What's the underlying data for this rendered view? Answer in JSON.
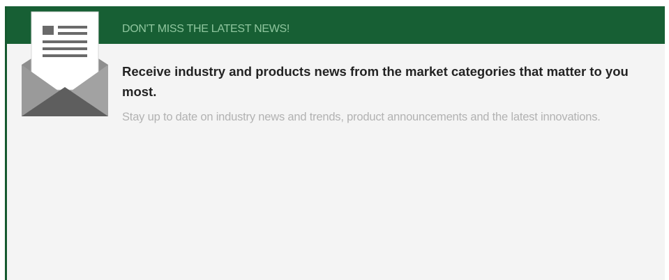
{
  "newsletter": {
    "banner_title": "DON'T MISS THE LATEST NEWS!",
    "headline": "Receive industry and products news from the market categories that matter to you most.",
    "description": "Stay up to date on industry news and trends, product announcements and the latest innovations.",
    "icon": "envelope-newsletter-icon"
  },
  "colors": {
    "header_green": "#175f34",
    "panel_background": "#f4f4f4",
    "headline_text": "#232323",
    "description_text": "#b2b2b2",
    "banner_text": "#8fc69e"
  }
}
